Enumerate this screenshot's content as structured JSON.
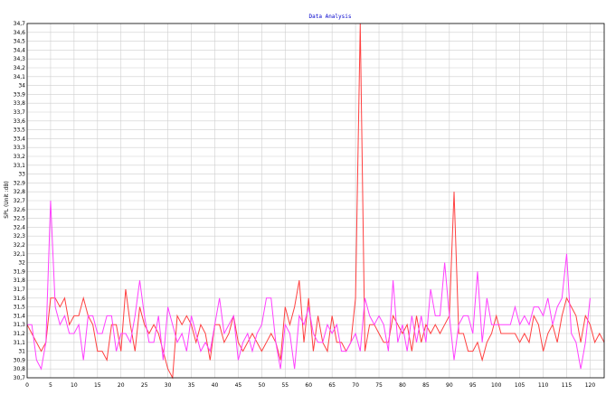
{
  "chart_data": {
    "type": "line",
    "title": "Data Analysis",
    "ylabel": "SPL   (Unit :dB)",
    "xlabel": "",
    "xlim": [
      0,
      123
    ],
    "ylim": [
      30.7,
      34.7
    ],
    "grid": true,
    "x_ticks": [
      0,
      5,
      10,
      15,
      20,
      25,
      30,
      35,
      40,
      45,
      50,
      55,
      60,
      65,
      70,
      75,
      80,
      85,
      90,
      95,
      100,
      105,
      110,
      115,
      120
    ],
    "y_ticks": [
      "30,7",
      "30,8",
      "30,9",
      "31",
      "31,1",
      "31,2",
      "31,3",
      "31,4",
      "31,5",
      "31,6",
      "31,7",
      "31,8",
      "31,9",
      "32",
      "32,1",
      "32,2",
      "32,3",
      "32,4",
      "32,5",
      "32,6",
      "32,7",
      "32,8",
      "32,9",
      "33",
      "33,1",
      "33,2",
      "33,3",
      "33,4",
      "33,5",
      "33,6",
      "33,7",
      "33,8",
      "33,9",
      "34",
      "34,1",
      "34,2",
      "34,3",
      "34,4",
      "34,5",
      "34,6",
      "34,7"
    ],
    "series": [
      {
        "color": "#ff4040",
        "values": [
          31.3,
          31.2,
          31.1,
          31.0,
          31.1,
          31.6,
          31.6,
          31.5,
          31.6,
          31.3,
          31.4,
          31.4,
          31.6,
          31.4,
          31.3,
          31.0,
          31.0,
          30.9,
          31.3,
          31.3,
          31.0,
          31.7,
          31.3,
          31.0,
          31.5,
          31.3,
          31.2,
          31.3,
          31.2,
          31.0,
          30.8,
          30.7,
          31.4,
          31.3,
          31.4,
          31.3,
          31.1,
          31.3,
          31.2,
          30.9,
          31.3,
          31.3,
          31.1,
          31.2,
          31.4,
          31.1,
          31.0,
          31.1,
          31.2,
          31.1,
          31.0,
          31.1,
          31.2,
          31.1,
          30.9,
          31.5,
          31.3,
          31.5,
          31.8,
          31.1,
          31.6,
          31.0,
          31.4,
          31.1,
          31.0,
          31.4,
          31.1,
          31.1,
          31.0,
          31.1,
          31.6,
          34.7,
          31.0,
          31.3,
          31.3,
          31.2,
          31.1,
          31.1,
          31.4,
          31.3,
          31.2,
          31.3,
          31.0,
          31.4,
          31.1,
          31.3,
          31.2,
          31.3,
          31.2,
          31.3,
          31.4,
          32.8,
          31.2,
          31.2,
          31.0,
          31.0,
          31.1,
          30.9,
          31.1,
          31.2,
          31.4,
          31.2,
          31.2,
          31.2,
          31.2,
          31.1,
          31.2,
          31.1,
          31.4,
          31.3,
          31.0,
          31.2,
          31.3,
          31.1,
          31.4,
          31.6,
          31.5,
          31.4,
          31.1,
          31.4,
          31.3,
          31.1,
          31.2,
          31.1
        ]
      },
      {
        "color": "#ff40ff",
        "values": [
          31.3,
          31.3,
          30.9,
          30.8,
          31.1,
          32.7,
          31.5,
          31.3,
          31.4,
          31.2,
          31.2,
          31.3,
          30.9,
          31.4,
          31.4,
          31.2,
          31.2,
          31.4,
          31.4,
          31.0,
          31.2,
          31.2,
          31.1,
          31.4,
          31.8,
          31.4,
          31.1,
          31.1,
          31.4,
          30.9,
          31.5,
          31.3,
          31.1,
          31.2,
          31.0,
          31.4,
          31.2,
          31.0,
          31.1,
          31.0,
          31.3,
          31.6,
          31.2,
          31.3,
          31.4,
          30.9,
          31.1,
          31.2,
          31.0,
          31.2,
          31.3,
          31.6,
          31.6,
          31.1,
          30.8,
          31.3,
          31.2,
          30.8,
          31.4,
          31.3,
          31.5,
          31.2,
          31.1,
          31.1,
          31.3,
          31.2,
          31.3,
          31.0,
          31.0,
          31.1,
          31.2,
          31.0,
          31.6,
          31.4,
          31.3,
          31.4,
          31.3,
          31.0,
          31.8,
          31.1,
          31.3,
          31.0,
          31.4,
          31.1,
          31.4,
          31.1,
          31.7,
          31.4,
          31.4,
          32.0,
          31.4,
          30.9,
          31.3,
          31.4,
          31.4,
          31.2,
          31.9,
          31.1,
          31.6,
          31.3,
          31.3,
          31.3,
          31.3,
          31.3,
          31.5,
          31.3,
          31.4,
          31.3,
          31.5,
          31.5,
          31.4,
          31.6,
          31.3,
          31.5,
          31.6,
          32.1,
          31.2,
          31.1,
          30.8,
          31.1,
          31.6
        ]
      }
    ]
  }
}
